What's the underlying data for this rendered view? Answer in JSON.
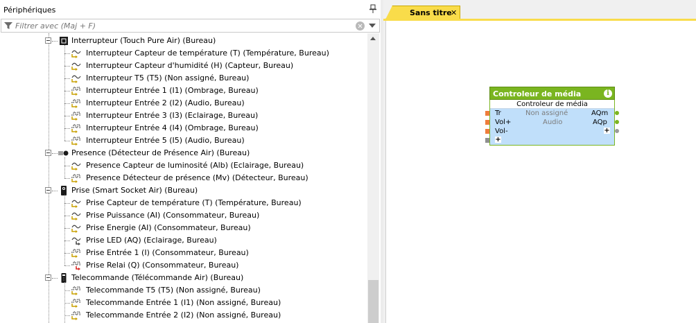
{
  "panel": {
    "title": "Périphériques",
    "pin_icon": "pin-icon"
  },
  "filter": {
    "placeholder": "Filtrer avec (Maj + F)"
  },
  "tree": {
    "groups": [
      {
        "label": "Interrupteur (Touch Pure Air) (Bureau)",
        "icon": "switch-device-icon",
        "children": [
          {
            "label": "Interrupteur Capteur de température (T) (Température, Bureau)",
            "icon": "analog-input-icon"
          },
          {
            "label": "Interrupteur Capteur d'humidité (H) (Capteur, Bureau)",
            "icon": "analog-input-icon"
          },
          {
            "label": "Interrupteur T5 (T5) (Non assigné, Bureau)",
            "icon": "analog-input-icon"
          },
          {
            "label": "Interrupteur Entrée 1 (I1) (Ombrage, Bureau)",
            "icon": "digital-input-icon"
          },
          {
            "label": "Interrupteur Entrée 2 (I2) (Audio, Bureau)",
            "icon": "digital-input-icon"
          },
          {
            "label": "Interrupteur Entrée 3 (I3) (Eclairage, Bureau)",
            "icon": "digital-input-icon"
          },
          {
            "label": "Interrupteur Entrée 4 (I4) (Ombrage, Bureau)",
            "icon": "digital-input-icon"
          },
          {
            "label": "Interrupteur Entrée 5 (I5) (Audio, Bureau)",
            "icon": "digital-input-icon"
          }
        ]
      },
      {
        "label": "Presence (Détecteur de Présence Air) (Bureau)",
        "icon": "presence-sensor-icon",
        "children": [
          {
            "label": "Presence Capteur de luminosité (Alb) (Eclairage, Bureau)",
            "icon": "analog-input-icon"
          },
          {
            "label": "Presence Détecteur de présence (Mv) (Détecteur, Bureau)",
            "icon": "digital-input-icon"
          }
        ]
      },
      {
        "label": "Prise (Smart Socket Air) (Bureau)",
        "icon": "smart-socket-icon",
        "children": [
          {
            "label": "Prise Capteur de température (T) (Température, Bureau)",
            "icon": "analog-input-icon"
          },
          {
            "label": "Prise Puissance (AI) (Consommateur, Bureau)",
            "icon": "analog-input-icon"
          },
          {
            "label": "Prise Energie (AI) (Consommateur, Bureau)",
            "icon": "analog-input-icon"
          },
          {
            "label": "Prise LED (AQ) (Eclairage, Bureau)",
            "icon": "analog-output-icon"
          },
          {
            "label": "Prise Entrée 1 (I) (Consommateur, Bureau)",
            "icon": "digital-input-icon"
          },
          {
            "label": "Prise Relai (Q) (Consommateur, Bureau)",
            "icon": "digital-output-icon"
          }
        ]
      },
      {
        "label": "Telecommande (Télécommande Air) (Bureau)",
        "icon": "remote-control-icon",
        "children": [
          {
            "label": "Telecommande T5 (T5) (Non assigné, Bureau)",
            "icon": "digital-input-icon"
          },
          {
            "label": "Telecommande Entrée 1 (I1) (Non assigné, Bureau)",
            "icon": "digital-input-icon"
          },
          {
            "label": "Telecommande Entrée 2 (I2) (Non assigné, Bureau)",
            "icon": "digital-input-icon"
          }
        ]
      }
    ]
  },
  "tab": {
    "title": "Sans titre",
    "close": "✕"
  },
  "block": {
    "title": "Controleur de média",
    "subtitle": "Controleur de média",
    "room": "Non assigné",
    "category": "Audio",
    "inputs": [
      "Tr",
      "Vol+",
      "Vol-"
    ],
    "outputs": [
      "AQm",
      "AQp"
    ],
    "add_symbol": "+",
    "info_symbol": "i",
    "header_color": "#7ab520",
    "body_color": "#c0dffa",
    "input_pin_color": "#ef7d3c"
  }
}
